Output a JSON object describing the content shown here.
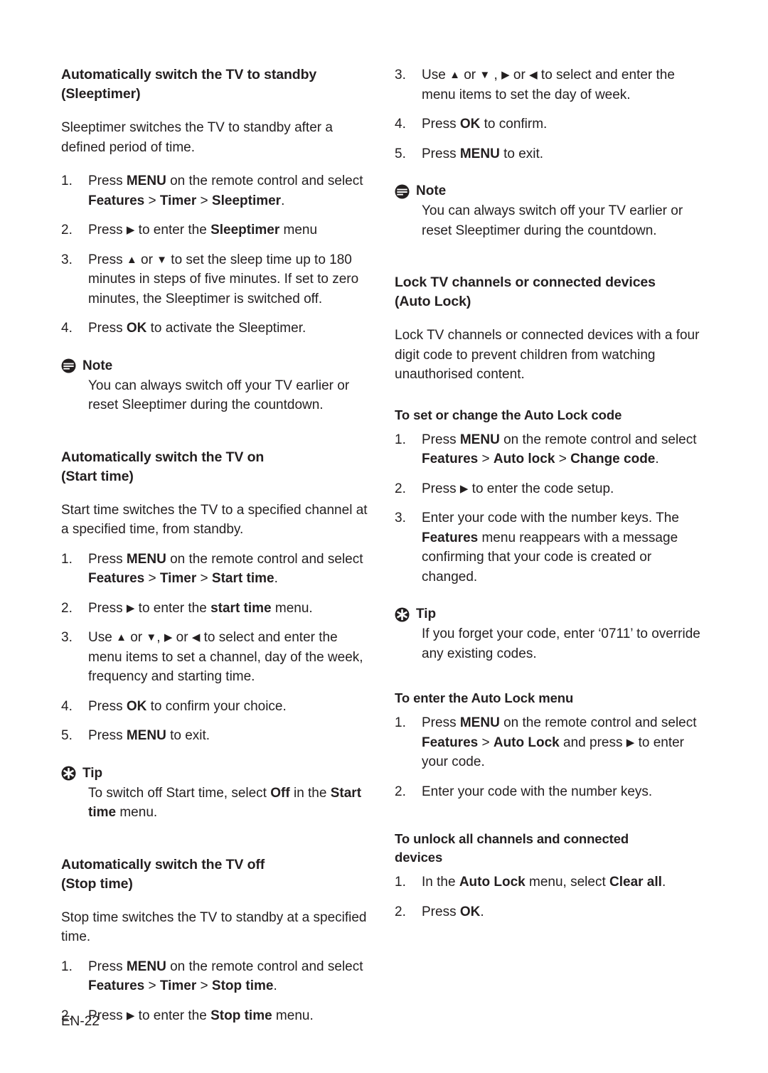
{
  "page": {
    "footer": "EN-22",
    "text_color": "#231f20",
    "background": "#ffffff"
  },
  "icons": {
    "note": "note-icon",
    "tip": "tip-icon",
    "arrow_right": "▶",
    "arrow_left": "◀",
    "arrow_up": "▲",
    "arrow_down": "▼"
  },
  "left_column": {
    "section1": {
      "heading_line1": "Automatically switch the TV to standby",
      "heading_line2": "(Sleeptimer)",
      "intro": "Sleeptimer switches the TV to standby after a defined period of time.",
      "steps": [
        {
          "num": "1.",
          "parts": [
            {
              "t": "Press ",
              "b": false
            },
            {
              "t": "MENU",
              "b": true
            },
            {
              "t": " on the remote control and select ",
              "b": false
            },
            {
              "t": "Features",
              "b": true
            },
            {
              "t": " > ",
              "b": false
            },
            {
              "t": "Timer",
              "b": true
            },
            {
              "t": " > ",
              "b": false
            },
            {
              "t": "Sleeptimer",
              "b": true
            },
            {
              "t": ".",
              "b": false
            }
          ]
        },
        {
          "num": "2.",
          "parts": [
            {
              "t": "Press ",
              "b": false
            },
            {
              "t": "▶",
              "b": false,
              "arrow": true
            },
            {
              "t": " to enter the ",
              "b": false
            },
            {
              "t": "Sleeptimer",
              "b": true
            },
            {
              "t": " menu",
              "b": false
            }
          ]
        },
        {
          "num": "3.",
          "parts": [
            {
              "t": "Press ",
              "b": false
            },
            {
              "t": "▲",
              "b": false,
              "arrow": true
            },
            {
              "t": " or ",
              "b": false
            },
            {
              "t": "▼",
              "b": false,
              "arrow": true
            },
            {
              "t": " to set the sleep time up to 180 minutes in steps of five minutes. If set to zero minutes, the Sleeptimer is switched off.",
              "b": false
            }
          ]
        },
        {
          "num": "4.",
          "parts": [
            {
              "t": "Press ",
              "b": false
            },
            {
              "t": "OK",
              "b": true
            },
            {
              "t": " to activate the Sleeptimer.",
              "b": false
            }
          ]
        }
      ],
      "note": {
        "label": "Note",
        "body": "You can always switch off your TV earlier or reset Sleeptimer during the countdown."
      }
    },
    "section2": {
      "heading_line1": "Automatically switch the TV on",
      "heading_line2": "(Start time)",
      "intro": "Start time switches the TV to a specified channel at a specified time, from standby.",
      "steps": [
        {
          "num": "1.",
          "parts": [
            {
              "t": "Press ",
              "b": false
            },
            {
              "t": "MENU",
              "b": true
            },
            {
              "t": " on the remote control and select ",
              "b": false
            },
            {
              "t": "Features",
              "b": true
            },
            {
              "t": " > ",
              "b": false
            },
            {
              "t": "Timer",
              "b": true
            },
            {
              "t": " > ",
              "b": false
            },
            {
              "t": "Start time",
              "b": true
            },
            {
              "t": ".",
              "b": false
            }
          ]
        },
        {
          "num": "2.",
          "parts": [
            {
              "t": "Press ",
              "b": false
            },
            {
              "t": "▶",
              "b": false,
              "arrow": true
            },
            {
              "t": " to enter the ",
              "b": false
            },
            {
              "t": "start time",
              "b": true
            },
            {
              "t": " menu.",
              "b": false
            }
          ]
        },
        {
          "num": "3.",
          "parts": [
            {
              "t": "Use ",
              "b": false
            },
            {
              "t": "▲",
              "b": false,
              "arrow": true
            },
            {
              "t": " or ",
              "b": false
            },
            {
              "t": "▼",
              "b": false,
              "arrow": true
            },
            {
              "t": ", ",
              "b": false
            },
            {
              "t": "▶",
              "b": false,
              "arrow": true
            },
            {
              "t": " or ",
              "b": false
            },
            {
              "t": "◀",
              "b": false,
              "arrow": true
            },
            {
              "t": " to select and enter the menu items to set a channel, day of the week, frequency and starting time.",
              "b": false
            }
          ]
        },
        {
          "num": "4.",
          "parts": [
            {
              "t": "Press ",
              "b": false
            },
            {
              "t": "OK",
              "b": true
            },
            {
              "t": " to confirm your choice.",
              "b": false
            }
          ]
        },
        {
          "num": "5.",
          "parts": [
            {
              "t": "Press ",
              "b": false
            },
            {
              "t": "MENU",
              "b": true
            },
            {
              "t": " to exit.",
              "b": false
            }
          ]
        }
      ],
      "tip": {
        "label": "Tip",
        "parts": [
          {
            "t": "To switch off Start time, select ",
            "b": false
          },
          {
            "t": "Off",
            "b": true
          },
          {
            "t": " in the ",
            "b": false
          },
          {
            "t": "Start time",
            "b": true
          },
          {
            "t": " menu.",
            "b": false
          }
        ]
      }
    },
    "section3": {
      "heading_line1": "Automatically switch the TV off",
      "heading_line2": "(Stop time)",
      "intro": "Stop time switches the TV to standby at a specified time.",
      "steps": [
        {
          "num": "1.",
          "parts": [
            {
              "t": "Press ",
              "b": false
            },
            {
              "t": "MENU",
              "b": true
            },
            {
              "t": " on the remote control and select ",
              "b": false
            },
            {
              "t": "Features",
              "b": true
            },
            {
              "t": " > ",
              "b": false
            },
            {
              "t": "Timer",
              "b": true
            },
            {
              "t": " > ",
              "b": false
            },
            {
              "t": "Stop time",
              "b": true
            },
            {
              "t": ".",
              "b": false
            }
          ]
        },
        {
          "num": "2.",
          "parts": [
            {
              "t": "Press ",
              "b": false
            },
            {
              "t": "▶",
              "b": false,
              "arrow": true
            },
            {
              "t": " to enter the ",
              "b": false
            },
            {
              "t": "Stop time",
              "b": true
            },
            {
              "t": " menu.",
              "b": false
            }
          ]
        }
      ]
    }
  },
  "right_column": {
    "continued_steps": [
      {
        "num": "3.",
        "parts": [
          {
            "t": "Use ",
            "b": false
          },
          {
            "t": "▲",
            "b": false,
            "arrow": true
          },
          {
            "t": " or ",
            "b": false
          },
          {
            "t": "▼",
            "b": false,
            "arrow": true
          },
          {
            "t": " , ",
            "b": false
          },
          {
            "t": "▶",
            "b": false,
            "arrow": true
          },
          {
            "t": " or ",
            "b": false
          },
          {
            "t": "◀",
            "b": false,
            "arrow": true
          },
          {
            "t": " to select and enter the menu items to set the day of week.",
            "b": false
          }
        ]
      },
      {
        "num": "4.",
        "parts": [
          {
            "t": "Press ",
            "b": false
          },
          {
            "t": "OK",
            "b": true
          },
          {
            "t": " to confirm.",
            "b": false
          }
        ]
      },
      {
        "num": "5.",
        "parts": [
          {
            "t": "Press ",
            "b": false
          },
          {
            "t": "MENU",
            "b": true
          },
          {
            "t": " to exit.",
            "b": false
          }
        ]
      }
    ],
    "note": {
      "label": "Note",
      "body": "You can always switch off your TV earlier or reset Sleeptimer during the countdown."
    },
    "section_lock": {
      "heading_line1": "Lock TV channels or connected devices",
      "heading_line2": "(Auto Lock)",
      "intro": "Lock TV channels or connected devices with a four digit code to prevent children from watching unauthorised content."
    },
    "subsection_setcode": {
      "heading": "To set or change the Auto Lock code",
      "steps": [
        {
          "num": "1.",
          "parts": [
            {
              "t": "Press ",
              "b": false
            },
            {
              "t": "MENU",
              "b": true
            },
            {
              "t": " on the remote control and select ",
              "b": false
            },
            {
              "t": "Features",
              "b": true
            },
            {
              "t": " > ",
              "b": false
            },
            {
              "t": "Auto lock",
              "b": true
            },
            {
              "t": " > ",
              "b": false
            },
            {
              "t": "Change code",
              "b": true
            },
            {
              "t": ".",
              "b": false
            }
          ]
        },
        {
          "num": "2.",
          "parts": [
            {
              "t": "Press ",
              "b": false
            },
            {
              "t": "▶",
              "b": false,
              "arrow": true
            },
            {
              "t": " to enter the code setup.",
              "b": false
            }
          ]
        },
        {
          "num": "3.",
          "parts": [
            {
              "t": "Enter your code with the number keys. The ",
              "b": false
            },
            {
              "t": "Features",
              "b": true
            },
            {
              "t": " menu reappears with a message confirming that your code is created or changed.",
              "b": false
            }
          ]
        }
      ],
      "tip": {
        "label": "Tip",
        "body": "If you forget your code, enter ‘0711’ to override any existing codes."
      }
    },
    "subsection_entermenu": {
      "heading": "To enter the Auto Lock menu",
      "steps": [
        {
          "num": "1.",
          "parts": [
            {
              "t": "Press ",
              "b": false
            },
            {
              "t": "MENU",
              "b": true
            },
            {
              "t": " on the remote control and select ",
              "b": false
            },
            {
              "t": "Features",
              "b": true
            },
            {
              "t": " > ",
              "b": false
            },
            {
              "t": "Auto Lock",
              "b": true
            },
            {
              "t": " and press ",
              "b": false
            },
            {
              "t": "▶",
              "b": false,
              "arrow": true
            },
            {
              "t": " to enter your code.",
              "b": false
            }
          ]
        },
        {
          "num": "2.",
          "parts": [
            {
              "t": "Enter your code with the number keys.",
              "b": false
            }
          ]
        }
      ]
    },
    "subsection_unlock": {
      "heading_line1": "To unlock all channels and connected",
      "heading_line2": "devices",
      "steps": [
        {
          "num": "1.",
          "parts": [
            {
              "t": "In the ",
              "b": false
            },
            {
              "t": "Auto Lock",
              "b": true
            },
            {
              "t": " menu, select ",
              "b": false
            },
            {
              "t": "Clear all",
              "b": true
            },
            {
              "t": ".",
              "b": false
            }
          ]
        },
        {
          "num": "2.",
          "parts": [
            {
              "t": "Press ",
              "b": false
            },
            {
              "t": "OK",
              "b": true
            },
            {
              "t": ".",
              "b": false
            }
          ]
        }
      ]
    }
  }
}
